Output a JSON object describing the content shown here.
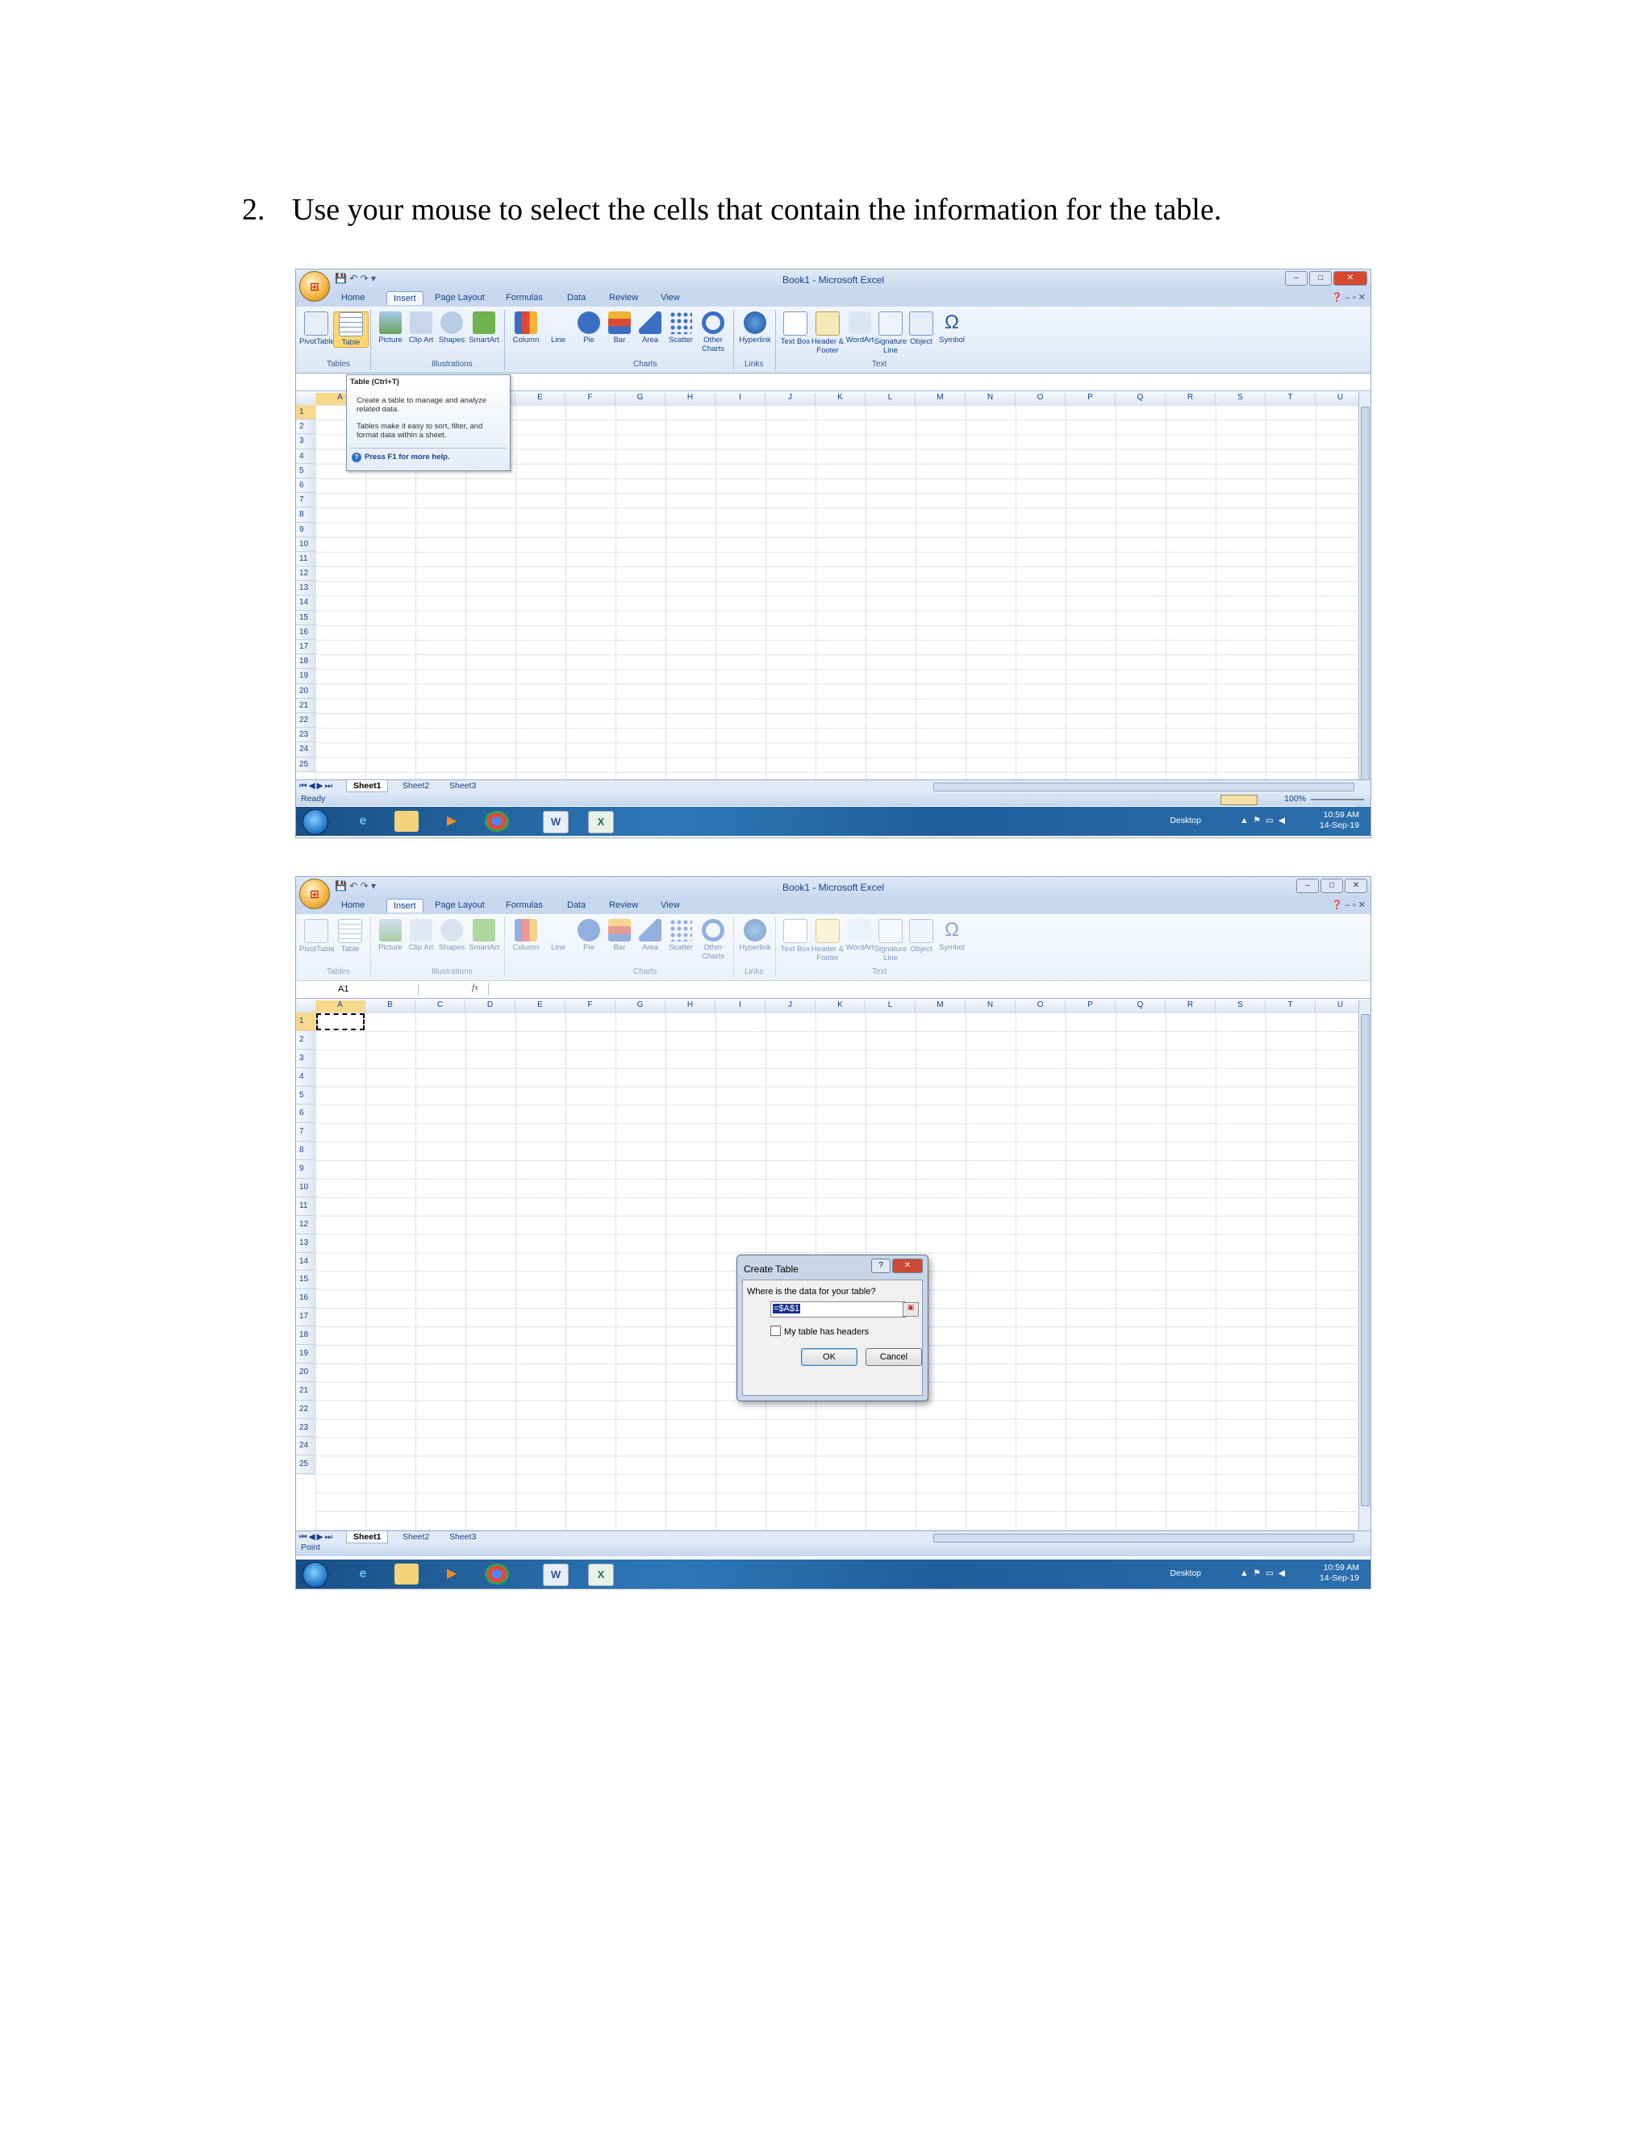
{
  "instruction": {
    "number": "2.",
    "text": "Use your mouse to select the cells that contain the information for the table."
  },
  "excel": {
    "title": "Book1 - Microsoft Excel",
    "tabs": [
      "Home",
      "Insert",
      "Page Layout",
      "Formulas",
      "Data",
      "Review",
      "View"
    ],
    "active_tab": "Insert",
    "ribbon_items": [
      "PivotTable",
      "Table",
      "Picture",
      "Clip Art",
      "Shapes",
      "SmartArt",
      "Column",
      "Line",
      "Pie",
      "Bar",
      "Area",
      "Scatter",
      "Other Charts",
      "Hyperlink",
      "Text Box",
      "Header & Footer",
      "WordArt",
      "Signature Line",
      "Object",
      "Symbol"
    ],
    "ribbon_groups": [
      "Tables",
      "Illustrations",
      "Charts",
      "Links",
      "Text"
    ],
    "columns": [
      "A",
      "B",
      "C",
      "D",
      "E",
      "F",
      "G",
      "H",
      "I",
      "J",
      "K",
      "L",
      "M",
      "N",
      "O",
      "P",
      "Q",
      "R",
      "S",
      "T",
      "U"
    ],
    "rows": [
      "1",
      "2",
      "3",
      "4",
      "5",
      "6",
      "7",
      "8",
      "9",
      "10",
      "11",
      "12",
      "13",
      "14",
      "15",
      "16",
      "17",
      "18",
      "19",
      "20",
      "21",
      "22",
      "23",
      "24",
      "25"
    ],
    "sheets": [
      "Sheet1",
      "Sheet2",
      "Sheet3"
    ],
    "zoom": "100%",
    "taskbar": {
      "desktop": "Desktop",
      "time": "10:59 AM",
      "date": "14-Sep-19"
    }
  },
  "shot1": {
    "status": "Ready",
    "tooltip": {
      "title": "Table (Ctrl+T)",
      "line1": "Create a table to manage and analyze related data.",
      "line2": "Tables make it easy to sort, filter, and format data within a sheet.",
      "help": "Press F1 for more help."
    }
  },
  "shot2": {
    "status": "Point",
    "name_box": "A1",
    "dialog": {
      "title": "Create Table",
      "question": "Where is the data for your table?",
      "range": "=$A$1",
      "checkbox_label": "My table has headers",
      "ok": "OK",
      "cancel": "Cancel"
    }
  }
}
